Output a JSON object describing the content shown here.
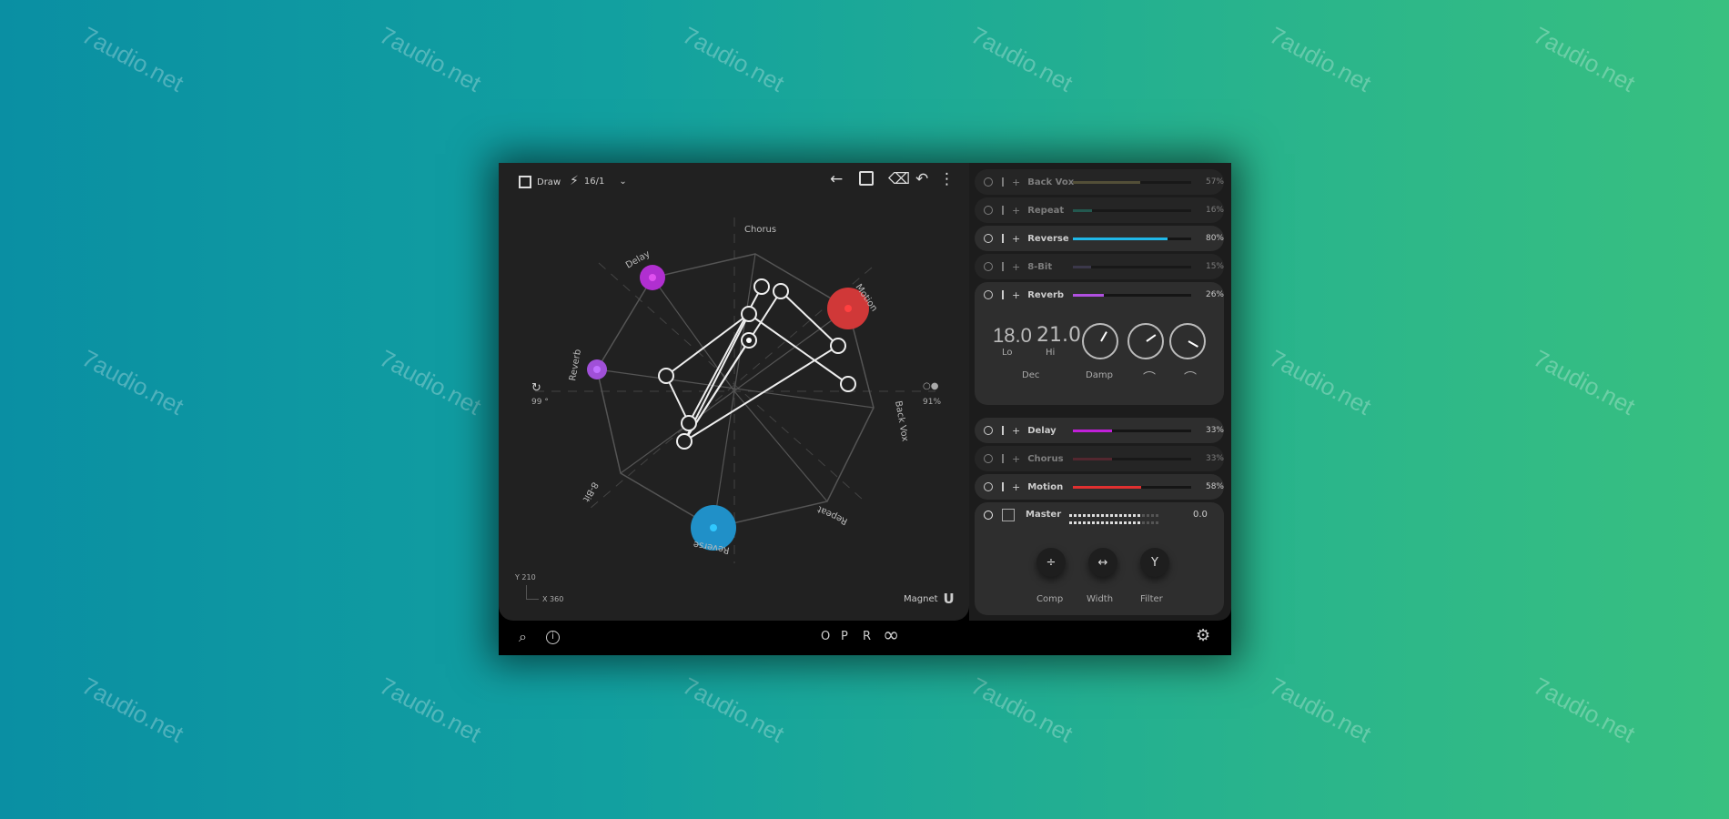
{
  "watermark": "7audio.net",
  "toolbar": {
    "draw_label": "Draw",
    "rate_label": "16/1",
    "icons": [
      "draw-frame-icon",
      "runner-icon",
      "chevron-down-icon",
      "arrow-left-icon",
      "dice-icon",
      "eraser-icon",
      "undo-icon",
      "more-vertical-icon"
    ]
  },
  "graph": {
    "labels": {
      "chorus": "Chorus",
      "delay": "Delay",
      "motion": "Motion",
      "reverb": "Reverb",
      "backvox": "Back Vox",
      "repeat": "Repeat",
      "reverse": "Reverse",
      "bit": "8-Bit"
    },
    "rotation": "99 °",
    "scale": "91%",
    "y": "Y 210",
    "x": "X 360",
    "magnet": "Magnet",
    "colors": {
      "delay": "#b02fd0",
      "reverb": "#a050d8",
      "motion": "#d03838",
      "reverse": "#2090c8"
    }
  },
  "effects": [
    {
      "name": "Back Vox",
      "value": "57%",
      "level": 57,
      "color": "#807a50",
      "dim": true
    },
    {
      "name": "Repeat",
      "value": "16%",
      "level": 16,
      "color": "#2a8a7a",
      "dim": true
    },
    {
      "name": "Reverse",
      "value": "80%",
      "level": 80,
      "color": "#20b8e8",
      "dim": false
    },
    {
      "name": "8-Bit",
      "value": "15%",
      "level": 15,
      "color": "#555070",
      "dim": true
    },
    {
      "name": "Reverb",
      "value": "26%",
      "level": 26,
      "color": "#b050e0",
      "dim": false
    },
    {
      "name": "Delay",
      "value": "33%",
      "level": 33,
      "color": "#c020d8",
      "dim": false
    },
    {
      "name": "Chorus",
      "value": "33%",
      "level": 33,
      "color": "#803040",
      "dim": true
    },
    {
      "name": "Motion",
      "value": "58%",
      "level": 58,
      "color": "#e03030",
      "dim": false
    }
  ],
  "reverb_detail": {
    "lo_value": "18.0",
    "lo_label": "Lo",
    "hi_value": "21.0",
    "hi_label": "Hi",
    "dec_label": "Dec",
    "damp_label": "Damp"
  },
  "master": {
    "label": "Master",
    "value": "0.0",
    "comp": "Comp",
    "width": "Width",
    "filter": "Filter"
  },
  "bottom": {
    "modes": [
      "O",
      "P",
      "R"
    ]
  }
}
